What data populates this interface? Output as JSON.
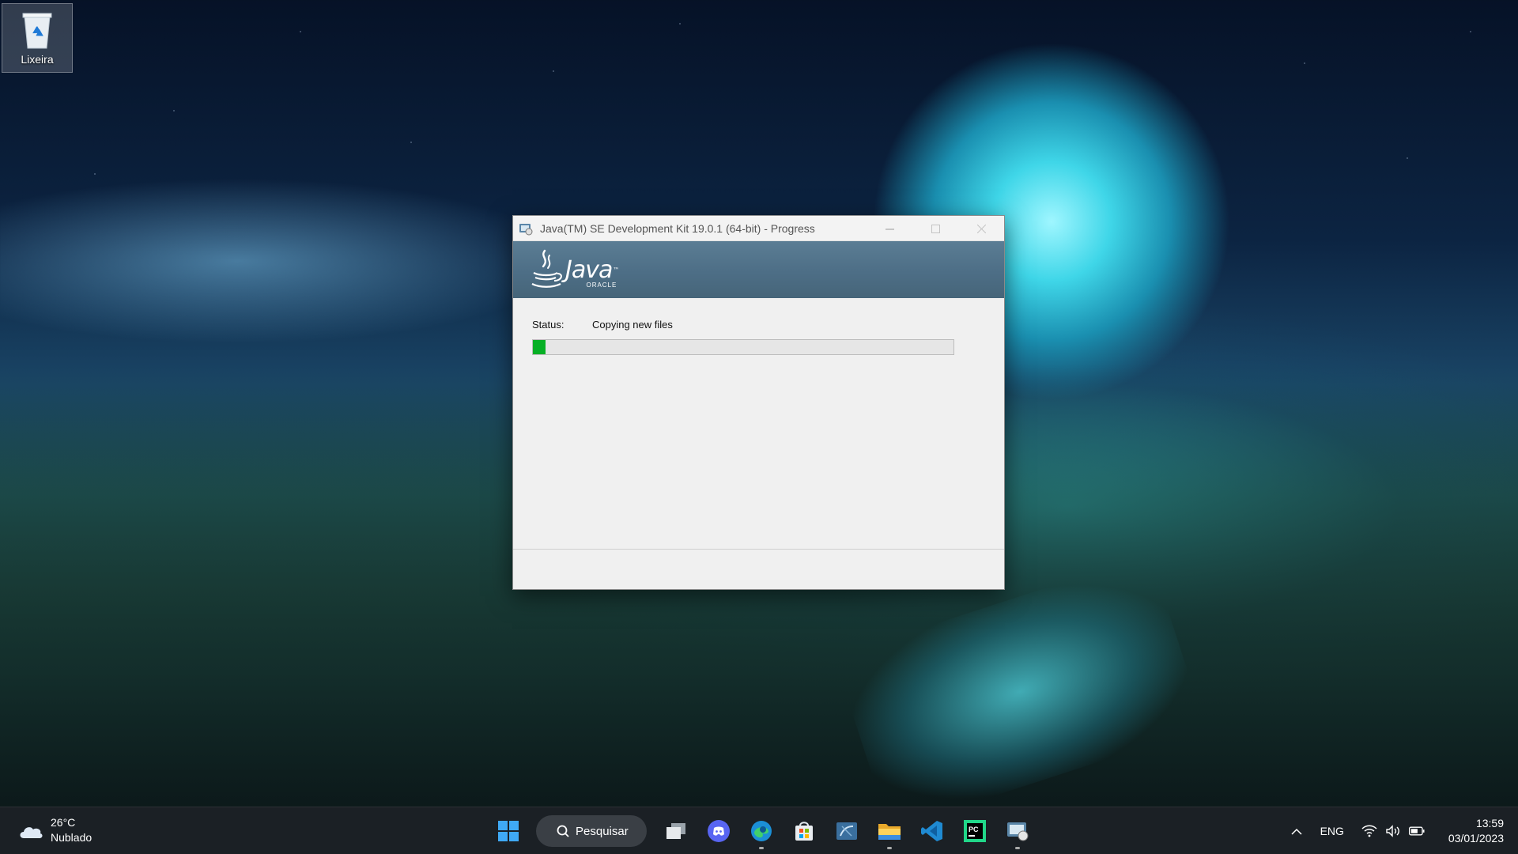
{
  "desktop": {
    "icons": [
      {
        "label": "Lixeira",
        "icon": "recycle-bin-icon"
      }
    ]
  },
  "installer": {
    "title": "Java(TM) SE Development Kit 19.0.1 (64-bit) - Progress",
    "logo": {
      "wordmark": "Java",
      "trademark": "™",
      "vendor": "ORACLE"
    },
    "status_label": "Status:",
    "status_value": "Copying new files",
    "progress_fraction": 0.03,
    "colors": {
      "banner": "#4d6e86",
      "progress_fill": "#06b025"
    }
  },
  "taskbar": {
    "weather": {
      "temperature": "26°C",
      "condition": "Nublado",
      "icon": "cloud-icon"
    },
    "search_label": "Pesquisar",
    "apps": [
      "start-icon",
      "task-view-icon",
      "discord-icon",
      "edge-icon",
      "store-icon",
      "sql-tool-icon",
      "file-explorer-icon",
      "vscode-icon",
      "pycharm-icon",
      "java-installer-icon"
    ],
    "tray": {
      "language": "ENG",
      "time": "13:59",
      "date": "03/01/2023"
    }
  }
}
